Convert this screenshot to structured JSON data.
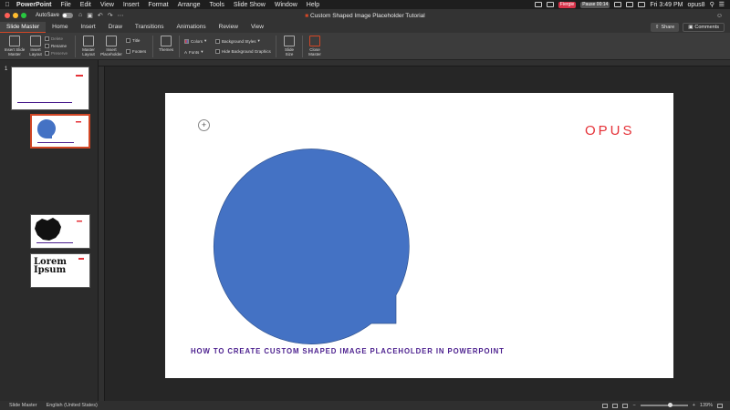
{
  "menubar": {
    "app": "PowerPoint",
    "items": [
      "File",
      "Edit",
      "View",
      "Insert",
      "Format",
      "Arrange",
      "Tools",
      "Slide Show",
      "Window",
      "Help"
    ],
    "badge_red": "Fiergie",
    "badge_grey": "Pause 00:14",
    "datetime": "Fri 3:49 PM",
    "user": "opus8"
  },
  "titlebar": {
    "autosave_label": "AutoSave",
    "autosave_state": "OFF",
    "doc_title": "Custom Shaped Image Placeholder Tutorial"
  },
  "tabs": [
    "Slide Master",
    "Home",
    "Insert",
    "Draw",
    "Transitions",
    "Animations",
    "Review",
    "View"
  ],
  "share_label": "Share",
  "comments_label": "Comments",
  "ribbon": {
    "insert_slide_master": "Insert Slide Master",
    "insert_layout": "Insert Layout",
    "delete": "Delete",
    "rename": "Rename",
    "preserve": "Preserve",
    "master_layout": "Master Layout",
    "insert_placeholder": "Insert Placeholder",
    "title": "Title",
    "footers": "Footers",
    "themes": "Themes",
    "colors": "Colors",
    "fonts": "Fonts",
    "background_styles": "Background Styles",
    "hide_background_graphics": "Hide Background Graphics",
    "slide_size": "Slide Size",
    "close_master": "Close Master"
  },
  "thumbnails": {
    "first_number": "1",
    "thumb3_text": "Lorem Ipsum"
  },
  "slide": {
    "logo": "OPUS",
    "caption": "HOW TO CREATE CUSTOM SHAPED IMAGE PLACEHOLDER IN POWERPOINT",
    "shape_color": "#4472c4"
  },
  "statusbar": {
    "view": "Slide Master",
    "language": "English (United States)",
    "zoom": "139%"
  }
}
